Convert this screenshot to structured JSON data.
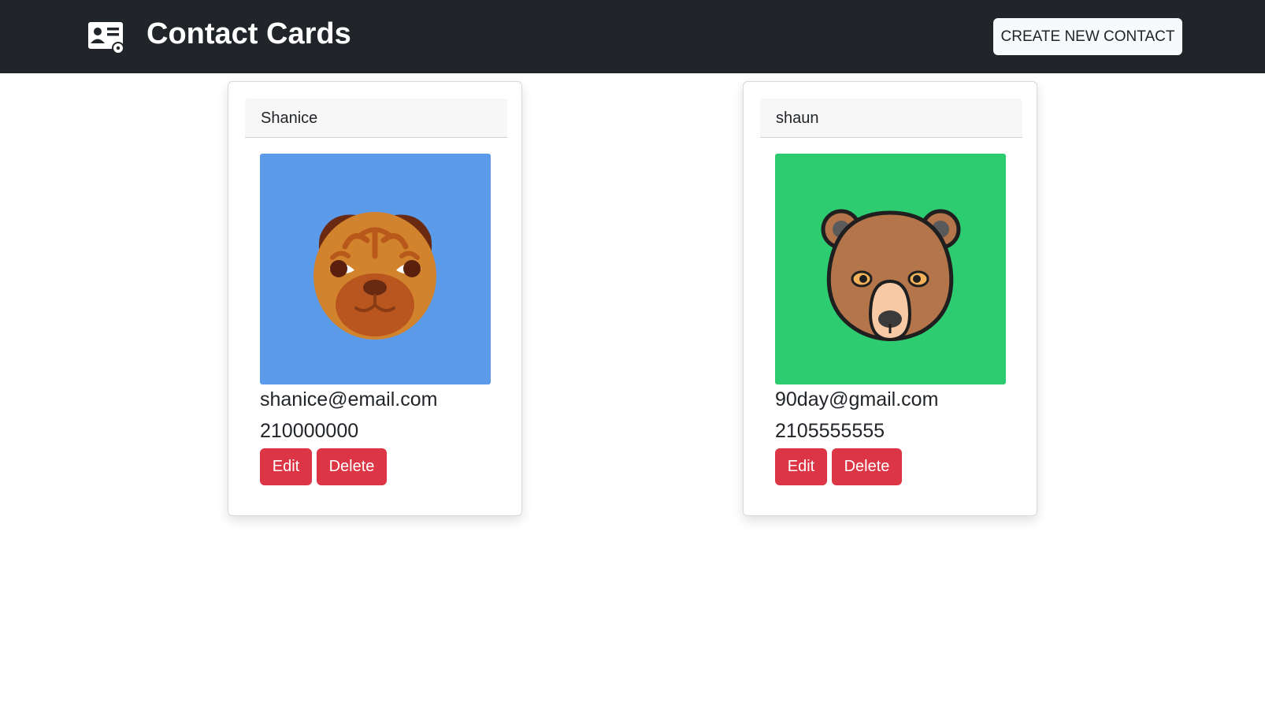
{
  "header": {
    "title": "Contact Cards",
    "create_label": "CREATE NEW CONTACT",
    "brand_icon": "contact-card-icon"
  },
  "contacts": [
    {
      "name": "Shanice",
      "email": "shanice@email.com",
      "phone": "210000000",
      "avatar_icon": "pug-dog-icon",
      "avatar_bg": "#5b9bea",
      "edit_label": "Edit",
      "delete_label": "Delete"
    },
    {
      "name": "shaun",
      "email": "90day@gmail.com",
      "phone": "2105555555",
      "avatar_icon": "bear-icon",
      "avatar_bg": "#2ecc71",
      "edit_label": "Edit",
      "delete_label": "Delete"
    }
  ],
  "colors": {
    "navbar": "#212529",
    "danger": "#dc3545",
    "light": "#f8f9fa"
  }
}
